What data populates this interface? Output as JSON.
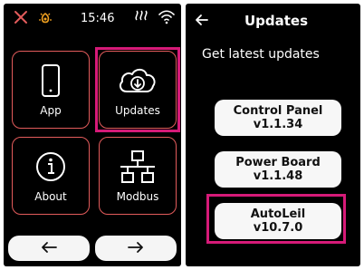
{
  "left_screen": {
    "status": {
      "time": "15:46"
    },
    "tiles": [
      {
        "label": "App"
      },
      {
        "label": "Updates"
      },
      {
        "label": "About"
      },
      {
        "label": "Modbus"
      }
    ],
    "nav": {
      "back_icon": "arrow-left-icon",
      "forward_icon": "arrow-right-icon"
    }
  },
  "right_screen": {
    "header": {
      "title": "Updates",
      "back_icon": "arrow-left-icon"
    },
    "subtitle": "Get latest updates",
    "items": [
      {
        "name": "Control Panel",
        "version": "v1.1.34"
      },
      {
        "name": "Power Board",
        "version": "v1.1.48"
      },
      {
        "name": "AutoLeil",
        "version": "v10.7.0"
      }
    ]
  },
  "colors": {
    "accent": "#e25b5b",
    "highlight": "#d61a78",
    "status_warning": "#f0a020"
  }
}
